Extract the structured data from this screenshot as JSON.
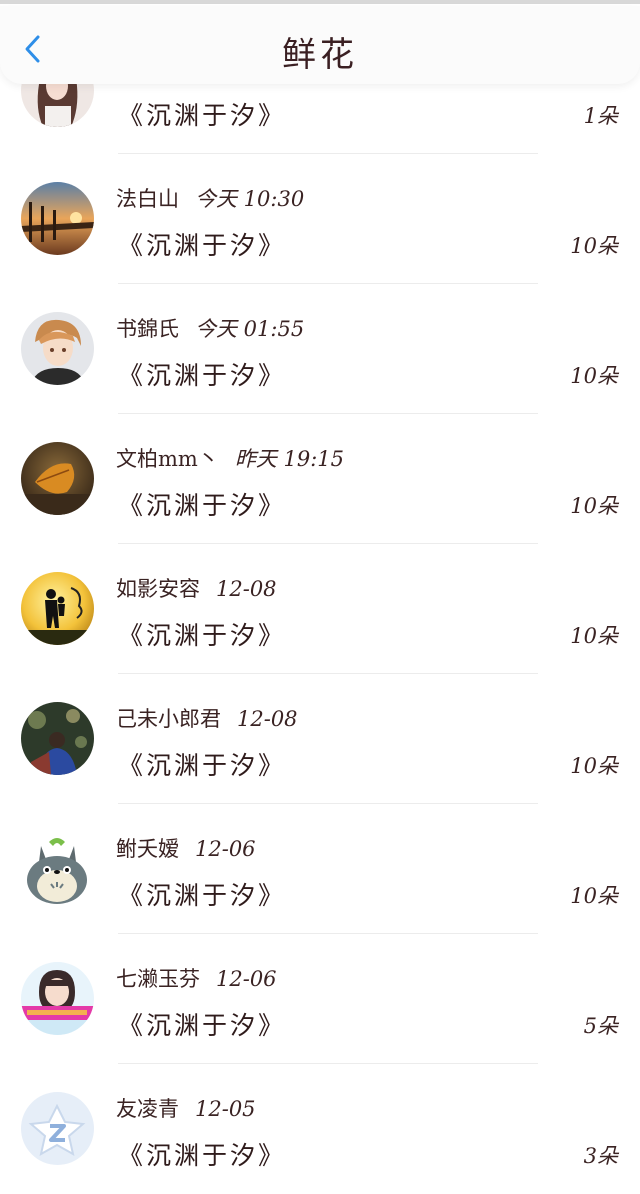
{
  "header": {
    "title": "鲜花",
    "back_icon": "chevron-left-icon"
  },
  "colors": {
    "accent": "#2e8ee8",
    "text": "#3a2323"
  },
  "items": [
    {
      "name": "",
      "time": "",
      "book": "《沉渊于汐》",
      "count": "1朵",
      "avatar": "girl-portrait"
    },
    {
      "name": "法白山",
      "time": "今天 10:30",
      "book": "《沉渊于汐》",
      "count": "10朵",
      "avatar": "sunset-pier"
    },
    {
      "name": "书錦氏",
      "time": "今天 01:55",
      "book": "《沉渊于汐》",
      "count": "10朵",
      "avatar": "anime-boy"
    },
    {
      "name": "文柏mm丶",
      "time": "昨天 19:15",
      "book": "《沉渊于汐》",
      "count": "10朵",
      "avatar": "autumn-leaf"
    },
    {
      "name": "如影安容",
      "time": "12-08",
      "book": "《沉渊于汐》",
      "count": "10朵",
      "avatar": "silhouette-sun"
    },
    {
      "name": "己未小郎君",
      "time": "12-08",
      "book": "《沉渊于汐》",
      "count": "10朵",
      "avatar": "night-scene"
    },
    {
      "name": "鲋夭嫒",
      "time": "12-06",
      "book": "《沉渊于汐》",
      "count": "10朵",
      "avatar": "totoro"
    },
    {
      "name": "七濑玉芬",
      "time": "12-06",
      "book": "《沉渊于汐》",
      "count": "5朵",
      "avatar": "girl-banner"
    },
    {
      "name": "友凌青",
      "time": "12-05",
      "book": "《沉渊于汐》",
      "count": "3朵",
      "avatar": "default-star"
    }
  ]
}
